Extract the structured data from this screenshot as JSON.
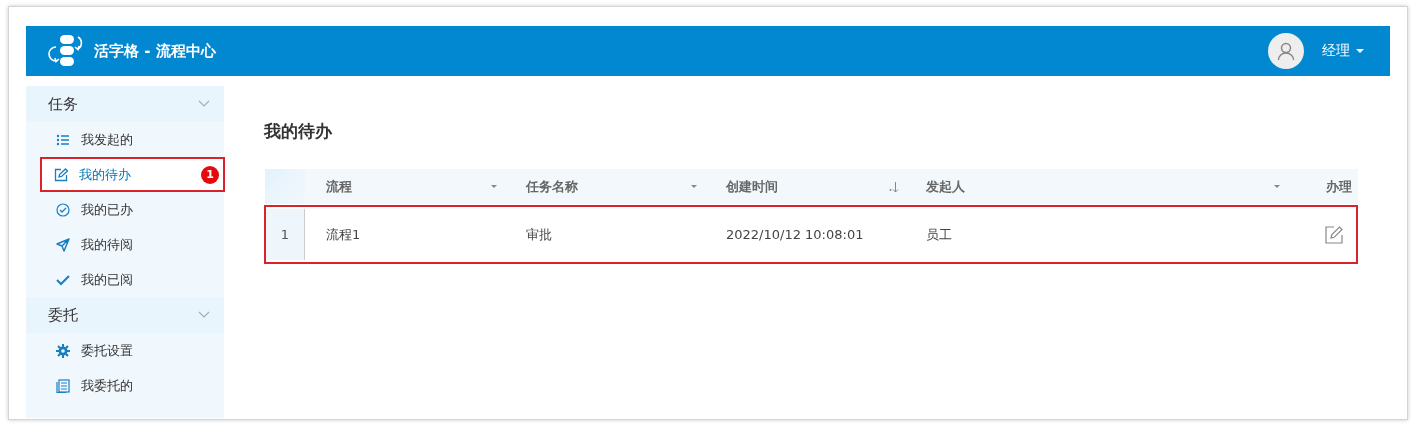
{
  "header": {
    "title": "活字格 - 流程中心",
    "user": "经理"
  },
  "sidebar": {
    "groups": [
      {
        "label": "任务",
        "expanded": true,
        "items": [
          {
            "label": "我发起的",
            "kind": "list",
            "selected": false,
            "highlighted": false
          },
          {
            "label": "我的待办",
            "kind": "edit",
            "selected": true,
            "highlighted": true,
            "badge": "1"
          },
          {
            "label": "我的已办",
            "kind": "done",
            "selected": false,
            "highlighted": false
          },
          {
            "label": "我的待阅",
            "kind": "send",
            "selected": false,
            "highlighted": false
          },
          {
            "label": "我的已阅",
            "kind": "read",
            "selected": false,
            "highlighted": false
          }
        ]
      },
      {
        "label": "委托",
        "expanded": true,
        "items": [
          {
            "label": "委托设置",
            "kind": "settings",
            "selected": false,
            "highlighted": false
          },
          {
            "label": "我委托的",
            "kind": "document",
            "selected": false,
            "highlighted": false
          }
        ]
      }
    ]
  },
  "page_title": "我的待办",
  "table": {
    "columns": [
      {
        "label": "流程",
        "kind": "menu"
      },
      {
        "label": "任务名称",
        "kind": "menu"
      },
      {
        "label": "创建时间",
        "kind": "sorted"
      },
      {
        "label": "发起人",
        "kind": "menu"
      },
      {
        "label": "办理",
        "kind": "action"
      }
    ],
    "rows": [
      {
        "number": "1",
        "cells": [
          "流程1",
          "审批",
          "2022/10/12 10:08:01",
          "员工"
        ],
        "highlighted": true
      }
    ]
  }
}
